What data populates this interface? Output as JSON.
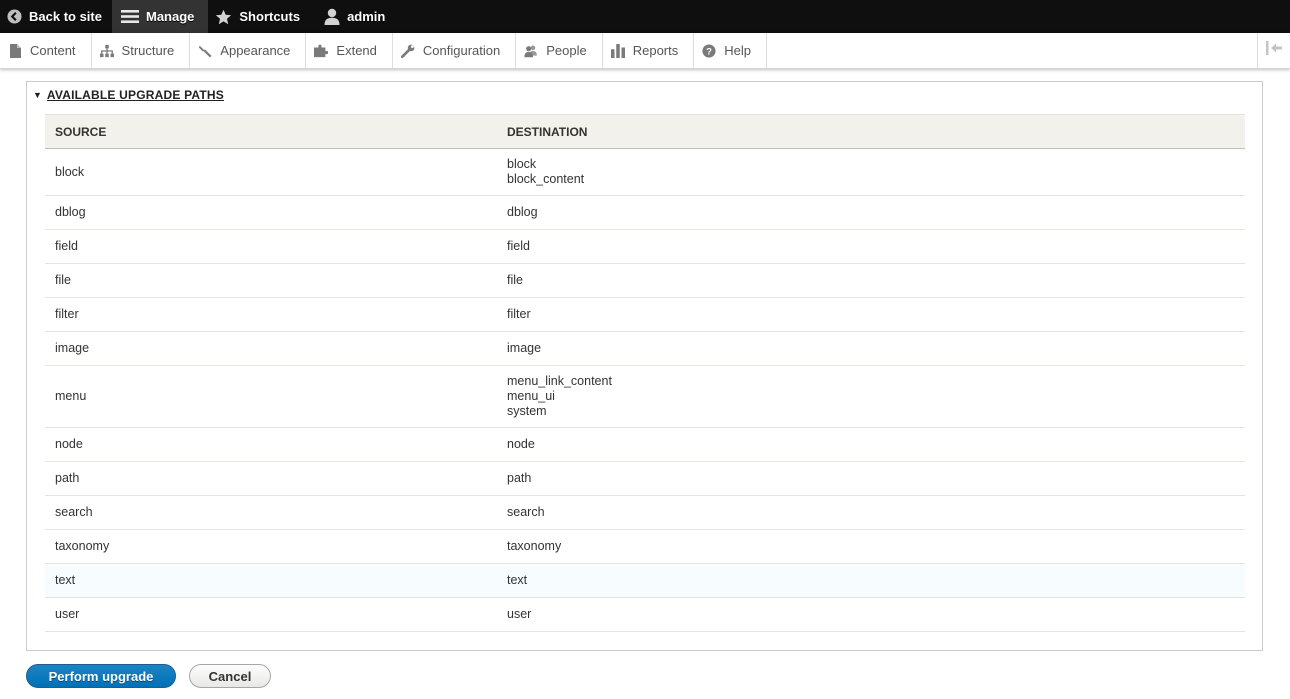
{
  "toolbar": {
    "back_label": "Back to site",
    "manage_label": "Manage",
    "shortcuts_label": "Shortcuts",
    "user_label": "admin"
  },
  "tray": {
    "items": [
      {
        "label": "Content",
        "icon": "page-icon"
      },
      {
        "label": "Structure",
        "icon": "structure-icon"
      },
      {
        "label": "Appearance",
        "icon": "brush-icon"
      },
      {
        "label": "Extend",
        "icon": "puzzle-icon"
      },
      {
        "label": "Configuration",
        "icon": "wrench-icon"
      },
      {
        "label": "People",
        "icon": "people-icon"
      },
      {
        "label": "Reports",
        "icon": "bar-chart-icon"
      },
      {
        "label": "Help",
        "icon": "help-icon"
      }
    ],
    "collapse_icon": "collapse-orientation-icon"
  },
  "upgrade_paths": {
    "summary": "AVAILABLE UPGRADE PATHS",
    "headers": {
      "source": "SOURCE",
      "destination": "DESTINATION"
    },
    "rows": [
      {
        "source": "block",
        "destinations": [
          "block",
          "block_content"
        ]
      },
      {
        "source": "dblog",
        "destinations": [
          "dblog"
        ]
      },
      {
        "source": "field",
        "destinations": [
          "field"
        ]
      },
      {
        "source": "file",
        "destinations": [
          "file"
        ]
      },
      {
        "source": "filter",
        "destinations": [
          "filter"
        ]
      },
      {
        "source": "image",
        "destinations": [
          "image"
        ]
      },
      {
        "source": "menu",
        "destinations": [
          "menu_link_content",
          "menu_ui",
          "system"
        ]
      },
      {
        "source": "node",
        "destinations": [
          "node"
        ]
      },
      {
        "source": "path",
        "destinations": [
          "path"
        ]
      },
      {
        "source": "search",
        "destinations": [
          "search"
        ]
      },
      {
        "source": "taxonomy",
        "destinations": [
          "taxonomy"
        ]
      },
      {
        "source": "text",
        "destinations": [
          "text"
        ]
      },
      {
        "source": "user",
        "destinations": [
          "user"
        ]
      }
    ]
  },
  "actions": {
    "perform_label": "Perform upgrade",
    "cancel_label": "Cancel"
  },
  "colors": {
    "toolbar_bg": "#0f0f0f",
    "primary_button": "#0071b8",
    "table_header_bg": "#f2f1eb"
  }
}
